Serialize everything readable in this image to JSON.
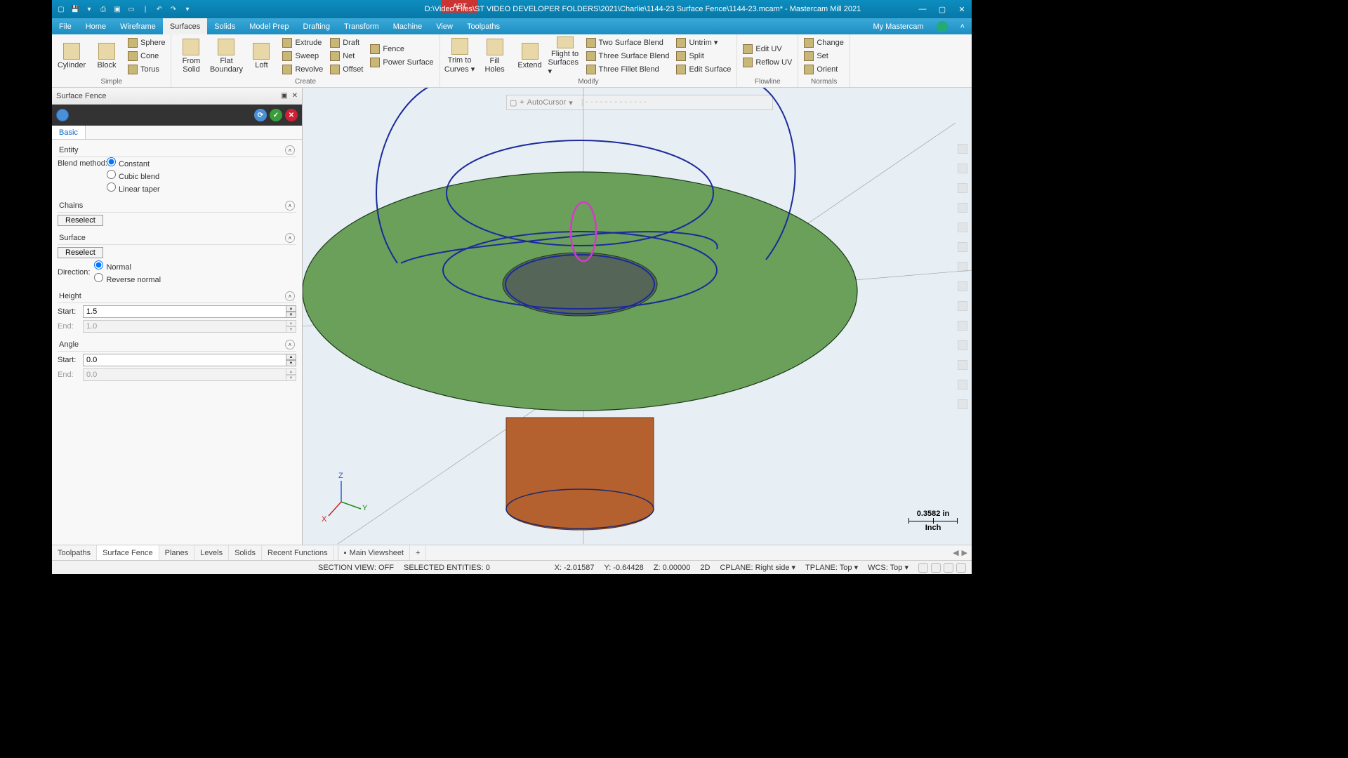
{
  "titlebar": {
    "path": "D:\\Video Files\\ST VIDEO DEVELOPER FOLDERS\\2021\\Charlie\\1144-23 Surface Fence\\1144-23.mcam* - Mastercam Mill 2021"
  },
  "menu": {
    "items": [
      "File",
      "Home",
      "Wireframe",
      "Surfaces",
      "Solids",
      "Model Prep",
      "Drafting",
      "Transform",
      "Machine",
      "View",
      "Toolpaths"
    ],
    "active": "Surfaces",
    "right": "My Mastercam"
  },
  "ribbon": {
    "groups": {
      "simple": {
        "label": "Simple",
        "big": [
          "Cylinder",
          "Block"
        ],
        "small": [
          "Sphere",
          "Cone",
          "Torus"
        ]
      },
      "create": {
        "label": "Create",
        "big": [
          [
            "From",
            "Solid"
          ],
          [
            "Flat",
            "Boundary"
          ],
          [
            "Loft",
            ""
          ]
        ],
        "col1": [
          "Extrude",
          "Sweep",
          "Revolve"
        ],
        "col2": [
          "Draft",
          "Net",
          "Offset"
        ],
        "col3": [
          "Fence",
          "Power Surface"
        ]
      },
      "modify": {
        "label": "Modify",
        "big": [
          [
            "Trim to",
            "Curves ▾"
          ],
          [
            "Fill",
            "Holes"
          ],
          [
            "Extend",
            ""
          ],
          [
            "Flight to",
            "Surfaces ▾"
          ]
        ],
        "col1": [
          "Two Surface Blend",
          "Three Surface Blend",
          "Three Fillet Blend"
        ],
        "col2": [
          "Untrim ▾",
          "Split",
          "Edit Surface"
        ]
      },
      "flowline": {
        "label": "Flowline",
        "items": [
          "Edit UV",
          "Reflow UV"
        ]
      },
      "normals": {
        "label": "Normals",
        "items": [
          "Change",
          "Set",
          "Orient"
        ]
      }
    }
  },
  "panel": {
    "title": "Surface Fence",
    "tab": "Basic",
    "entity": {
      "label": "Entity",
      "blend_label": "Blend method:",
      "options": [
        "Constant",
        "Cubic blend",
        "Linear taper"
      ],
      "selected": "Constant"
    },
    "chains": {
      "label": "Chains",
      "reselect": "Reselect"
    },
    "surface": {
      "label": "Surface",
      "reselect": "Reselect",
      "dir_label": "Direction:",
      "options": [
        "Normal",
        "Reverse normal"
      ],
      "selected": "Normal"
    },
    "height": {
      "label": "Height",
      "start_label": "Start:",
      "start": "1.5",
      "end_label": "End:",
      "end": "1.0"
    },
    "angle": {
      "label": "Angle",
      "start_label": "Start:",
      "start": "0.0",
      "end_label": "End:",
      "end": "0.0"
    }
  },
  "viewport": {
    "autocursor": "AutoCursor",
    "scale_val": "0.3582 in",
    "scale_unit": "Inch",
    "gnomon": {
      "z": "Z",
      "y": "Y",
      "x": "X"
    },
    "main_viewsheet": "Main Viewsheet"
  },
  "bottom_tabs": [
    "Toolpaths",
    "Surface Fence",
    "Planes",
    "Levels",
    "Solids",
    "Recent Functions"
  ],
  "bottom_active": "Surface Fence",
  "status": {
    "section": "SECTION VIEW: OFF",
    "selected": "SELECTED ENTITIES: 0",
    "x_lbl": "X:",
    "x": "-2.01587",
    "y_lbl": "Y:",
    "y": "-0.64428",
    "z_lbl": "Z:",
    "z": "0.00000",
    "mode": "2D",
    "cplane": "CPLANE: Right side ▾",
    "tplane": "TPLANE: Top ▾",
    "wcs": "WCS: Top ▾"
  }
}
